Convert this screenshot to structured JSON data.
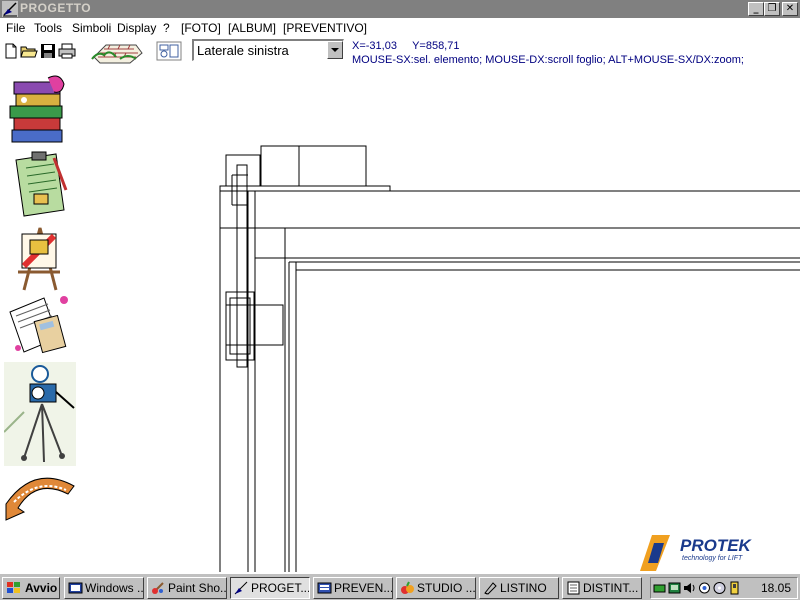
{
  "window": {
    "title": "PROGETTO",
    "controls": {
      "minimize": "_",
      "restore": "❐",
      "close": "✕"
    }
  },
  "menu": {
    "items": [
      {
        "label": "File"
      },
      {
        "label": "Tools"
      },
      {
        "label": "Simboli"
      },
      {
        "label": "Display"
      },
      {
        "label": "?"
      },
      {
        "label": "[FOTO]"
      },
      {
        "label": "[ALBUM]"
      },
      {
        "label": "[PREVENTIVO]"
      }
    ]
  },
  "toolbar": {
    "view_select": {
      "value": "Laterale sinistra"
    },
    "coords": {
      "x_label": "X=",
      "x": "-31,03",
      "y_label": "Y=",
      "y": "858,71"
    },
    "hint": "MOUSE-SX:sel. elemento; MOUSE-DX:scroll foglio; ALT+MOUSE-SX/DX:zoom;"
  },
  "sidebar": {
    "items": [
      {
        "icon": "books-icon"
      },
      {
        "icon": "clipboard-icon"
      },
      {
        "icon": "easel-icon"
      },
      {
        "icon": "documents-calculator-icon"
      },
      {
        "icon": "camera-tripod-icon"
      },
      {
        "icon": "preventivo-arrow-icon"
      }
    ]
  },
  "logo": {
    "name": "PROTEK",
    "tagline": "technology for LIFT"
  },
  "taskbar": {
    "start": "Avvio",
    "buttons": [
      {
        "label": "Windows ...",
        "icon": "windows-explorer-icon"
      },
      {
        "label": "Paint Sho...",
        "icon": "paint-shop-icon"
      },
      {
        "label": "PROGET...",
        "icon": "progetto-icon",
        "active": true
      },
      {
        "label": "PREVEN...",
        "icon": "preventivo-icon"
      },
      {
        "label": "STUDIO ...",
        "icon": "studio-icon"
      },
      {
        "label": "LISTINO",
        "icon": "listino-icon"
      },
      {
        "label": "DISTINT...",
        "icon": "distinta-icon"
      }
    ],
    "clock": "18.05"
  },
  "colors": {
    "titlebar_inactive": "#808080",
    "window_face": "#c0c0c0",
    "hint_text": "#000080",
    "logo_blue": "#1a3a8c",
    "logo_orange": "#f0a020"
  }
}
